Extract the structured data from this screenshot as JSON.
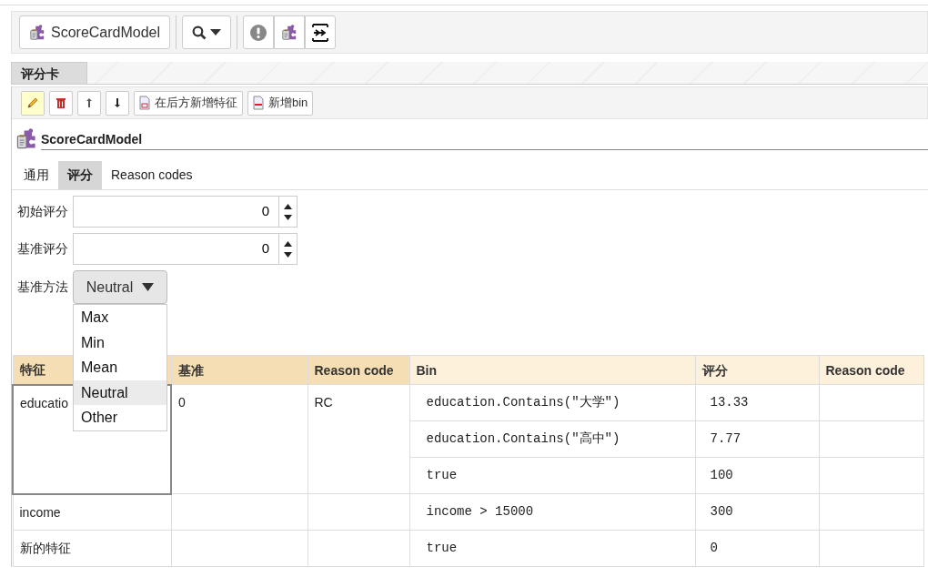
{
  "toolbar": {
    "model_button": "ScoreCardModel"
  },
  "panel_tab": {
    "label": "评分卡",
    "selected": true
  },
  "actions": [
    {
      "kind": "edit",
      "on": true
    },
    {
      "kind": "delete",
      "on": false
    },
    {
      "kind": "up",
      "on": false
    },
    {
      "kind": "down",
      "on": false
    },
    {
      "kind": "add-feature",
      "on": false,
      "label": "在后方新增特征"
    },
    {
      "kind": "add-bin",
      "on": false,
      "label": "新增bin"
    }
  ],
  "model_title": "ScoreCardModel",
  "tabs": [
    {
      "label": "通用",
      "selected": false
    },
    {
      "label": "评分",
      "selected": true
    },
    {
      "label": "Reason codes",
      "selected": false
    }
  ],
  "fields": [
    {
      "kind": "spinner",
      "label": "初始评分",
      "value": "0"
    },
    {
      "kind": "spinner",
      "label": "基准评分",
      "value": "0"
    },
    {
      "kind": "select",
      "label": "基准方法",
      "value": "Neutral",
      "expanded": true,
      "options": [
        {
          "label": "Max",
          "selected": false
        },
        {
          "label": "Min",
          "selected": false
        },
        {
          "label": "Mean",
          "selected": false
        },
        {
          "label": "Neutral",
          "selected": true
        },
        {
          "label": "Other",
          "selected": false
        }
      ]
    }
  ],
  "table": {
    "feature_columns": [
      "特征",
      "基准",
      "Reason code"
    ],
    "bin_columns": [
      "Bin",
      "评分",
      "Reason code"
    ],
    "rows": [
      {
        "feature": "educatio",
        "baseline": "0",
        "reason_code": "RC",
        "selected": true,
        "bins": [
          {
            "condition": "education.Contains(\"大学\")",
            "score": "13.33"
          },
          {
            "condition": "education.Contains(\"高中\")",
            "score": "7.77"
          },
          {
            "condition": "true",
            "score": "100"
          }
        ]
      },
      {
        "feature": "income",
        "selected": false,
        "bins": [
          {
            "condition": "income > 15000",
            "score": "300"
          }
        ]
      },
      {
        "feature": "新的特征",
        "selected": false,
        "bins": [
          {
            "condition": "true",
            "score": "0"
          }
        ]
      }
    ]
  }
}
